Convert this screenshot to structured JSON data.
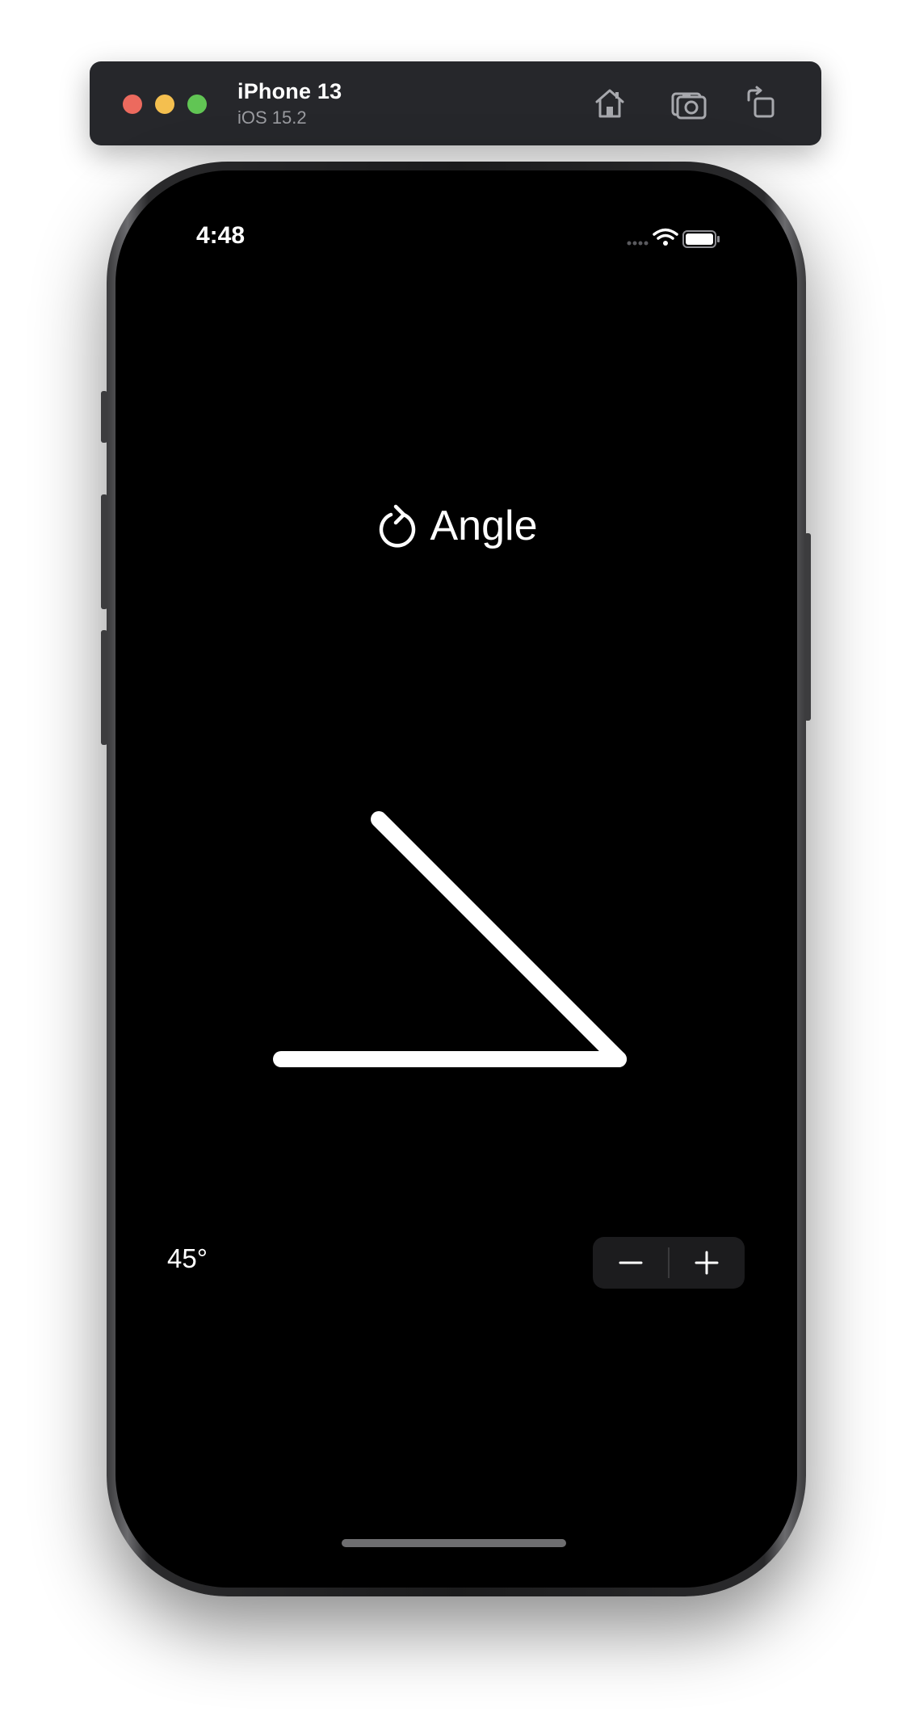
{
  "simulator": {
    "device_name": "iPhone 13",
    "os_version": "iOS 15.2",
    "toolbar_icons": [
      "home-icon",
      "screenshot-icon",
      "rotate-icon"
    ]
  },
  "status_bar": {
    "time": "4:48",
    "icons": [
      "cellular-icon",
      "wifi-icon",
      "battery-icon"
    ]
  },
  "header": {
    "icon": "rotate-arrow-icon",
    "title": "Angle"
  },
  "angle_control": {
    "value_degrees": 45,
    "value_label": "45°",
    "stroke_color": "#ffffff"
  },
  "stepper": {
    "decrement_icon": "minus-icon",
    "increment_icon": "plus-icon"
  },
  "colors": {
    "screen_background": "#000000",
    "toolbar_background": "#26272b",
    "stepper_background": "#1c1c1e"
  }
}
